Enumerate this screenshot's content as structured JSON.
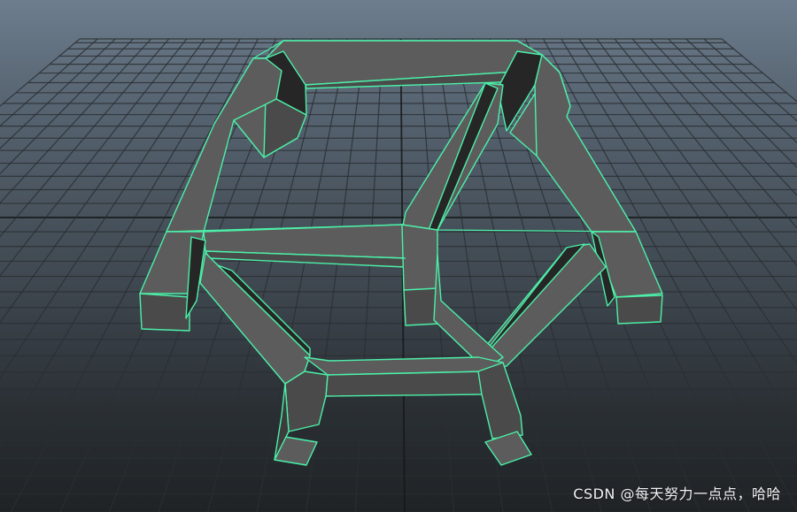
{
  "viewport": {
    "watermark": "CSDN @每天努力一点点，哈哈"
  },
  "colors": {
    "wireframe": "#4cf0a8",
    "background_top": "#6d7d8d",
    "background_bottom": "#1f2326",
    "mesh_face": "#5c5c5c",
    "grid": "#2b2f33"
  }
}
